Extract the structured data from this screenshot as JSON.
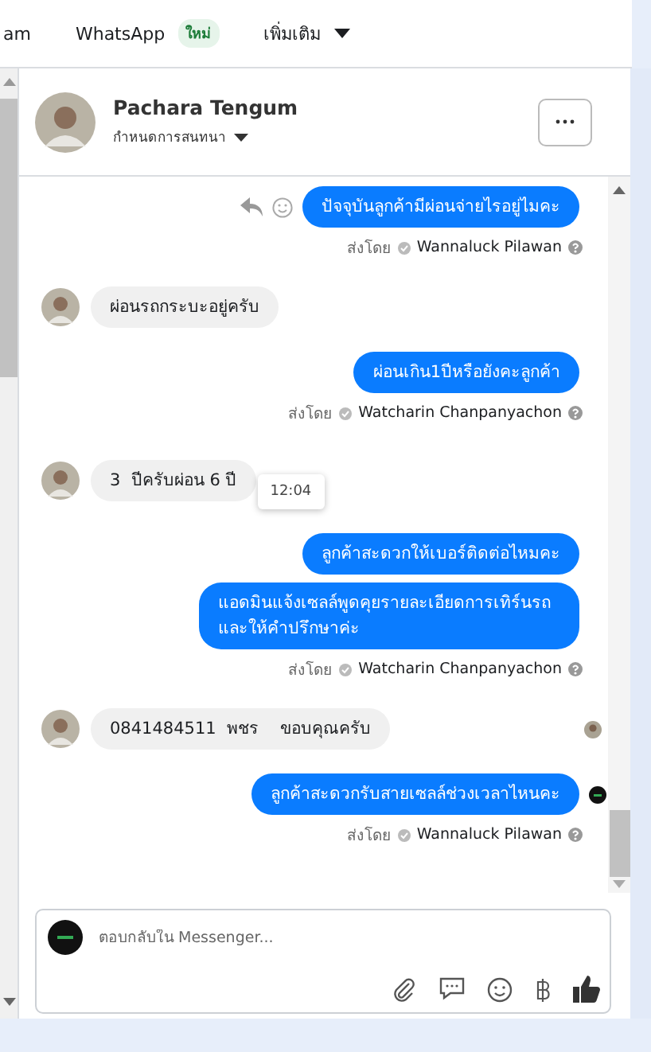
{
  "top_tabs": [
    {
      "label": "am"
    },
    {
      "label": "WhatsApp",
      "badge": "ใหม่"
    },
    {
      "label": "เพิ่มเติม",
      "caret": true
    }
  ],
  "contact": {
    "name": "Pachara Tengum",
    "subtitle": "กำหนดการสนทนา"
  },
  "messages": [
    {
      "kind": "outgoing",
      "text": "ปัจจุบันลูกค้ามีผ่อนจ่ายไรอยู่ไมคะ",
      "hover_actions": true,
      "sent_by": "ส่งโดย",
      "sender": "Wannaluck Pilawan"
    },
    {
      "kind": "incoming",
      "text": "ผ่อนรถกระบะอยู่ครับ"
    },
    {
      "kind": "outgoing",
      "text": "ผ่อนเกิน1ปีหรือยังคะลูกค้า",
      "sent_by": "ส่งโดย",
      "sender": "Watcharin Chanpanyachon"
    },
    {
      "kind": "incoming",
      "text": "3  ปีครับผ่อน 6 ปี",
      "tooltip": "12:04"
    },
    {
      "kind": "outgoing",
      "text": "ลูกค้าสะดวกให้เบอร์ติดต่อไหมคะ"
    },
    {
      "kind": "outgoing",
      "text": "แอดมินแจ้งเซลล์พูดคุยรายละเอียดการเทิร์นรถและให้คำปรึกษาค่ะ",
      "sent_by": "ส่งโดย",
      "sender": "Watcharin Chanpanyachon"
    },
    {
      "kind": "incoming",
      "text": "0841484511  พชร    ขอบคุณครับ",
      "seen_marker": true
    },
    {
      "kind": "outgoing",
      "text": "ลูกค้าสะดวกรับสายเซลล์ช่วงเวลาไหนคะ",
      "page_marker": true,
      "sent_by": "ส่งโดย",
      "sender": "Wannaluck Pilawan"
    }
  ],
  "composer": {
    "placeholder": "ตอบกลับใน Messenger..."
  }
}
